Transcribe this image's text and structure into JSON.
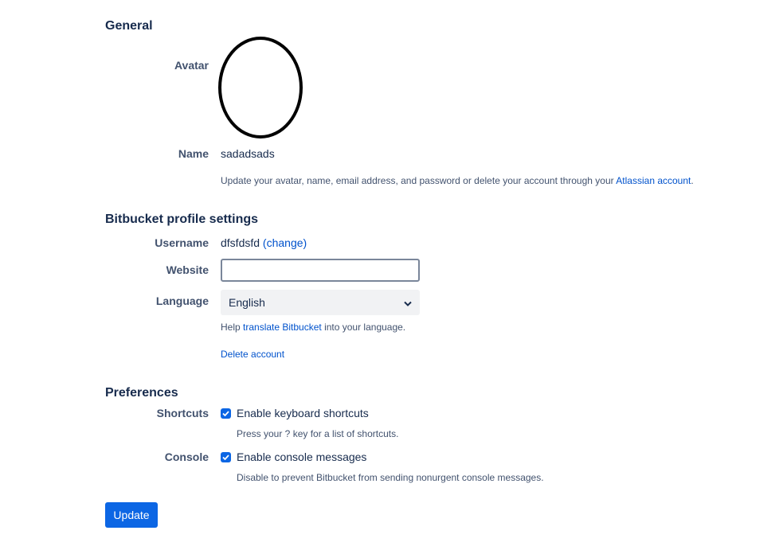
{
  "general": {
    "heading": "General",
    "avatar_label": "Avatar",
    "name_label": "Name",
    "name_value": "sadadsads",
    "help_prefix": "Update your avatar, name, email address, and password or delete your account through your ",
    "help_link": "Atlassian account",
    "help_suffix": "."
  },
  "profile": {
    "heading": "Bitbucket profile settings",
    "username_label": "Username",
    "username_value": "dfsfdsfd",
    "change_link": "(change)",
    "website_label": "Website",
    "website_value": "",
    "language_label": "Language",
    "language_value": "English",
    "translate_prefix": "Help ",
    "translate_link": "translate Bitbucket",
    "translate_suffix": " into your language.",
    "delete_account": "Delete account"
  },
  "preferences": {
    "heading": "Preferences",
    "shortcuts_label": "Shortcuts",
    "shortcuts_checkbox": "Enable keyboard shortcuts",
    "shortcuts_help": "Press your ? key for a list of shortcuts.",
    "console_label": "Console",
    "console_checkbox": "Enable console messages",
    "console_help": "Disable to prevent Bitbucket from sending nonurgent console messages."
  },
  "update_button": "Update",
  "colors": {
    "primary": "#0c66e4",
    "link": "#0052cc",
    "text": "#172b4d",
    "subtle": "#42526e"
  }
}
